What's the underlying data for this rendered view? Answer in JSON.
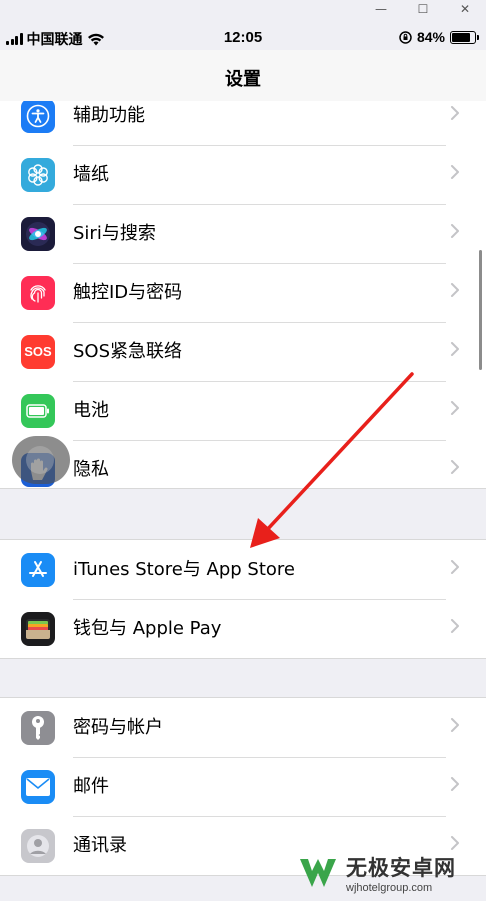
{
  "window": {
    "minimize": "—",
    "maximize": "☐",
    "close": "✕"
  },
  "status": {
    "carrier": "中国联通",
    "time": "12:05",
    "battery": "84%",
    "battery_level": 0.84
  },
  "nav": {
    "title": "设置"
  },
  "groups": [
    [
      {
        "name": "accessibility",
        "label": "辅助功能",
        "color": "#1c7cf5",
        "icon": "accessibility-icon"
      },
      {
        "name": "wallpaper",
        "label": "墙纸",
        "color": "#34aadc",
        "icon": "flower-icon"
      },
      {
        "name": "siri",
        "label": "Siri与搜索",
        "color": "#1b1b3a",
        "icon": "siri-icon"
      },
      {
        "name": "touch-id",
        "label": "触控ID与密码",
        "color": "#ff2d55",
        "icon": "fingerprint-icon"
      },
      {
        "name": "sos",
        "label": "SOS紧急联络",
        "color": "#ff3b30",
        "icon": "sos-icon",
        "text": "SOS"
      },
      {
        "name": "battery",
        "label": "电池",
        "color": "#34c759",
        "icon": "battery-icon"
      },
      {
        "name": "privacy",
        "label": "隐私",
        "color": "#1c5fd6",
        "icon": "hand-icon"
      }
    ],
    [
      {
        "name": "app-store",
        "label": "iTunes Store与 App Store",
        "color": "#1a8cf5",
        "icon": "app-store-icon"
      },
      {
        "name": "wallet",
        "label": "钱包与 Apple Pay",
        "color": "#1c1c1e",
        "icon": "wallet-icon"
      }
    ],
    [
      {
        "name": "passwords",
        "label": "密码与帐户",
        "color": "#8e8e93",
        "icon": "key-icon"
      },
      {
        "name": "mail",
        "label": "邮件",
        "color": "#1a8cf5",
        "icon": "mail-icon"
      },
      {
        "name": "contacts",
        "label": "通讯录",
        "color": "#c7c7cc",
        "icon": "contacts-icon"
      }
    ]
  ],
  "watermark": {
    "title": "无极安卓网",
    "url": "wjhotelgroup.com"
  },
  "annotation": {
    "icon": "red-arrow-icon"
  }
}
